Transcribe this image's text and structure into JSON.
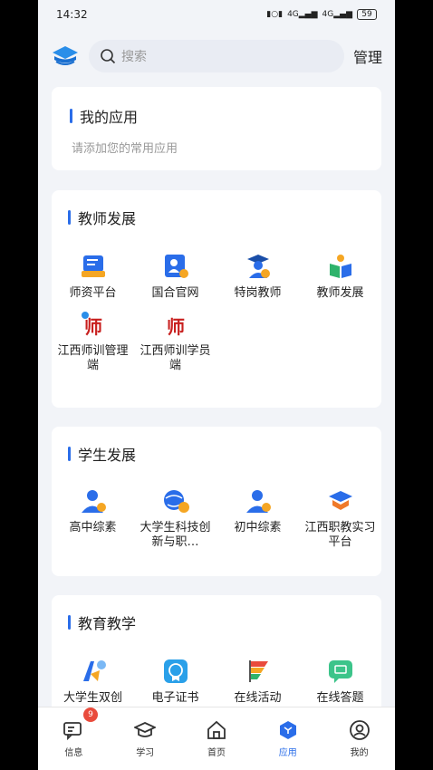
{
  "status": {
    "time": "14:32",
    "battery": "59",
    "net1": "4G",
    "net2": "4G"
  },
  "header": {
    "search_placeholder": "搜索",
    "manage_label": "管理"
  },
  "my_apps": {
    "title": "我的应用",
    "hint": "请添加您的常用应用"
  },
  "sections": [
    {
      "title": "教师发展",
      "apps": [
        {
          "label": "师资平台",
          "icon": "platform-icon"
        },
        {
          "label": "国合官网",
          "icon": "official-site-icon"
        },
        {
          "label": "特岗教师",
          "icon": "teacher-icon"
        },
        {
          "label": "教师发展",
          "icon": "book-person-icon"
        },
        {
          "label": "江西师训管理端",
          "icon": "shi-admin-icon"
        },
        {
          "label": "江西师训学员端",
          "icon": "shi-student-icon"
        }
      ]
    },
    {
      "title": "学生发展",
      "apps": [
        {
          "label": "高中综素",
          "icon": "highschool-icon"
        },
        {
          "label": "大学生科技创新与职…",
          "icon": "globe-icon"
        },
        {
          "label": "初中综素",
          "icon": "middleschool-icon"
        },
        {
          "label": "江西职教实习平台",
          "icon": "cap-icon"
        }
      ]
    },
    {
      "title": "教育教学",
      "apps": [
        {
          "label": "大学生双创",
          "icon": "shuangchuang-icon"
        },
        {
          "label": "电子证书",
          "icon": "certificate-icon"
        },
        {
          "label": "在线活动",
          "icon": "flag-icon"
        },
        {
          "label": "在线答题",
          "icon": "chat-quiz-icon"
        }
      ]
    }
  ],
  "tabs": [
    {
      "label": "信息",
      "icon": "message-icon",
      "badge": "9"
    },
    {
      "label": "学习",
      "icon": "graduation-cap-icon"
    },
    {
      "label": "首页",
      "icon": "home-icon"
    },
    {
      "label": "应用",
      "icon": "apps-cube-icon",
      "active": true
    },
    {
      "label": "我的",
      "icon": "profile-icon"
    }
  ],
  "colors": {
    "accent": "#2a6de9",
    "badge": "#e94b3c",
    "background": "#f2f4f8"
  }
}
